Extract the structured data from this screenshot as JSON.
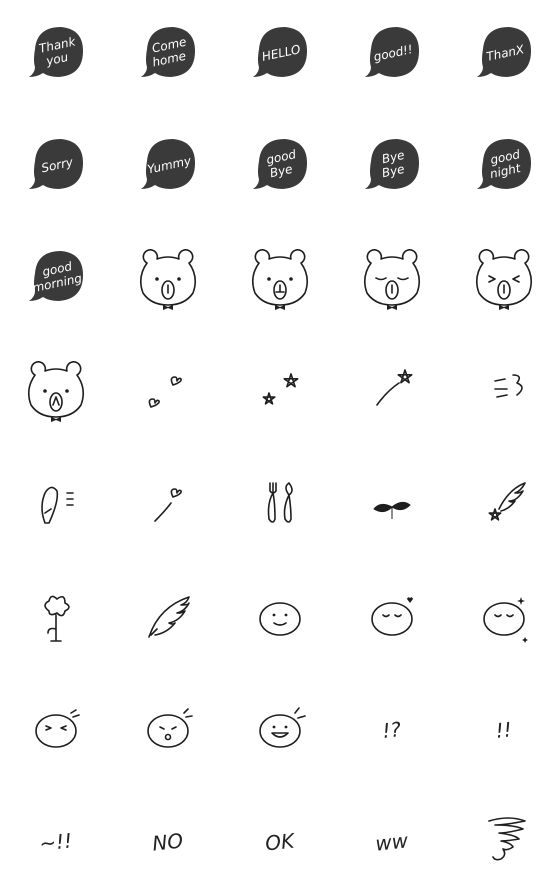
{
  "colors": {
    "bubble": "#3a3a3a",
    "ink": "#1e1e1e",
    "background": "#ffffff"
  },
  "stickers": [
    {
      "kind": "bubble",
      "lines": [
        "Thank",
        "you"
      ]
    },
    {
      "kind": "bubble",
      "lines": [
        "Come",
        "home"
      ]
    },
    {
      "kind": "bubble",
      "lines": [
        "HELLO"
      ]
    },
    {
      "kind": "bubble",
      "lines": [
        "good!!"
      ]
    },
    {
      "kind": "bubble",
      "lines": [
        "ThanX"
      ]
    },
    {
      "kind": "bubble",
      "lines": [
        "Sorry"
      ]
    },
    {
      "kind": "bubble",
      "lines": [
        "Yummy"
      ]
    },
    {
      "kind": "bubble",
      "lines": [
        "good",
        "Bye"
      ]
    },
    {
      "kind": "bubble",
      "lines": [
        "Bye",
        "Bye"
      ]
    },
    {
      "kind": "bubble",
      "lines": [
        "good",
        "night"
      ]
    },
    {
      "kind": "bubble",
      "lines": [
        "good",
        "morning"
      ]
    },
    {
      "kind": "bear",
      "face": "neutral"
    },
    {
      "kind": "bear",
      "face": "smile"
    },
    {
      "kind": "bear",
      "face": "sleepy"
    },
    {
      "kind": "bear",
      "face": "squint"
    },
    {
      "kind": "bear",
      "face": "surprised"
    },
    {
      "kind": "hearts"
    },
    {
      "kind": "stars"
    },
    {
      "kind": "shooting-star"
    },
    {
      "kind": "dash-lines"
    },
    {
      "kind": "lightbulb"
    },
    {
      "kind": "heart-flying"
    },
    {
      "kind": "spoon-fork"
    },
    {
      "kind": "sprout"
    },
    {
      "kind": "star-wing"
    },
    {
      "kind": "flower"
    },
    {
      "kind": "wing"
    },
    {
      "kind": "face",
      "face": "smile"
    },
    {
      "kind": "face",
      "face": "happy-heart"
    },
    {
      "kind": "face",
      "face": "sparkle"
    },
    {
      "kind": "face",
      "face": "squint"
    },
    {
      "kind": "face",
      "face": "surprised"
    },
    {
      "kind": "face",
      "face": "grin"
    },
    {
      "kind": "handtext",
      "text": "!?"
    },
    {
      "kind": "handtext",
      "text": "!!"
    },
    {
      "kind": "handtext",
      "text": "~!!"
    },
    {
      "kind": "handtext",
      "text": "NO"
    },
    {
      "kind": "handtext",
      "text": "OK"
    },
    {
      "kind": "handtext",
      "text": "ww"
    },
    {
      "kind": "tornado"
    }
  ]
}
